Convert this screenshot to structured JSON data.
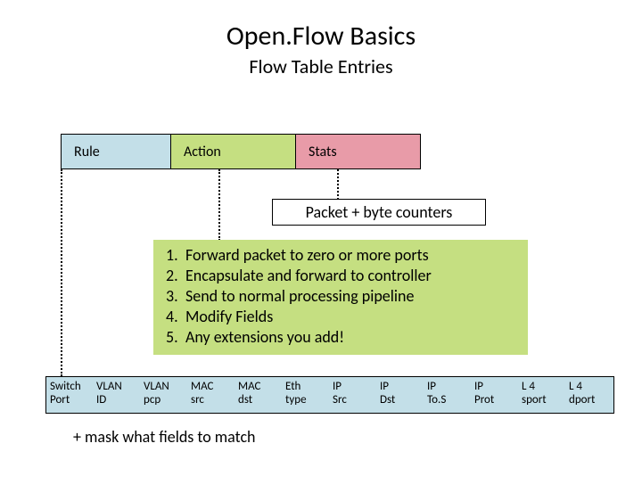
{
  "title": "Open.Flow Basics",
  "subtitle": "Flow Table Entries",
  "top_row": {
    "rule": "Rule",
    "action": "Action",
    "stats": "Stats"
  },
  "counters": "Packet + byte counters",
  "actions": [
    {
      "n": "1.",
      "text": "Forward packet to zero or more ports"
    },
    {
      "n": "2.",
      "text": "Encapsulate and forward to controller"
    },
    {
      "n": "3.",
      "text": "Send to normal processing pipeline"
    },
    {
      "n": "4.",
      "text": "Modify Fields"
    },
    {
      "n": "5.",
      "text": "Any extensions you add!"
    }
  ],
  "fields": [
    "Switch\nPort",
    "VLAN\nID",
    "VLAN\npcp",
    "MAC\nsrc",
    "MAC\ndst",
    "Eth\ntype",
    "IP\nSrc",
    "IP\nDst",
    "IP\nTo.S",
    "IP\nProt",
    "L 4\nsport",
    "L 4\ndport"
  ],
  "mask_note": "+ mask what fields to match"
}
